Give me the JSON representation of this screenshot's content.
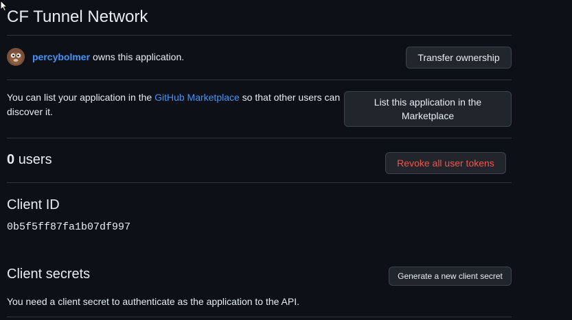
{
  "app": {
    "title": "CF Tunnel Network"
  },
  "owner": {
    "username": "percybolmer",
    "suffix": "owns this application.",
    "transfer_label": "Transfer ownership"
  },
  "marketplace": {
    "text_before": "You can list your application in the ",
    "link_text": "GitHub Marketplace",
    "text_after": " so that other users can discover it.",
    "button_label": "List this application in the Marketplace"
  },
  "users": {
    "count": "0",
    "label": "users",
    "revoke_label": "Revoke all user tokens"
  },
  "client_id": {
    "heading": "Client ID",
    "value": "0b5f5ff87fa1b07df997"
  },
  "client_secrets": {
    "heading": "Client secrets",
    "generate_label": "Generate a new client secret",
    "description": "You need a client secret to authenticate as the application to the API."
  },
  "colors": {
    "background": "#0d1117",
    "link": "#4493f8",
    "danger": "#f85149",
    "button_bg": "#21262d",
    "border": "#30363d"
  }
}
